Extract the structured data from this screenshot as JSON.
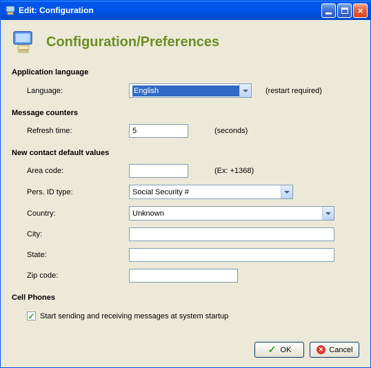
{
  "window": {
    "title": "Edit: Configuration"
  },
  "header": {
    "title": "Configuration/Preferences"
  },
  "sections": {
    "appLang": {
      "title": "Application language",
      "languageLabel": "Language:",
      "languageValue": "English",
      "restartHint": "(restart required)"
    },
    "msgCounters": {
      "title": "Message counters",
      "refreshLabel": "Refresh time:",
      "refreshValue": "5",
      "secondsHint": "(seconds)"
    },
    "newContact": {
      "title": "New contact default values",
      "areaCodeLabel": "Area code:",
      "areaCodeValue": "",
      "areaCodeHint": "(Ex: +1368)",
      "persIdLabel": "Pers. ID type:",
      "persIdValue": "Social Security #",
      "countryLabel": "Country:",
      "countryValue": "Unknown",
      "cityLabel": "City:",
      "cityValue": "",
      "stateLabel": "State:",
      "stateValue": "",
      "zipLabel": "Zip code:",
      "zipValue": ""
    },
    "cellPhones": {
      "title": "Cell Phones",
      "startupCheckboxLabel": "Start sending and receiving messages at system startup",
      "startupChecked": true
    }
  },
  "buttons": {
    "ok": "OK",
    "cancel": "Cancel"
  }
}
